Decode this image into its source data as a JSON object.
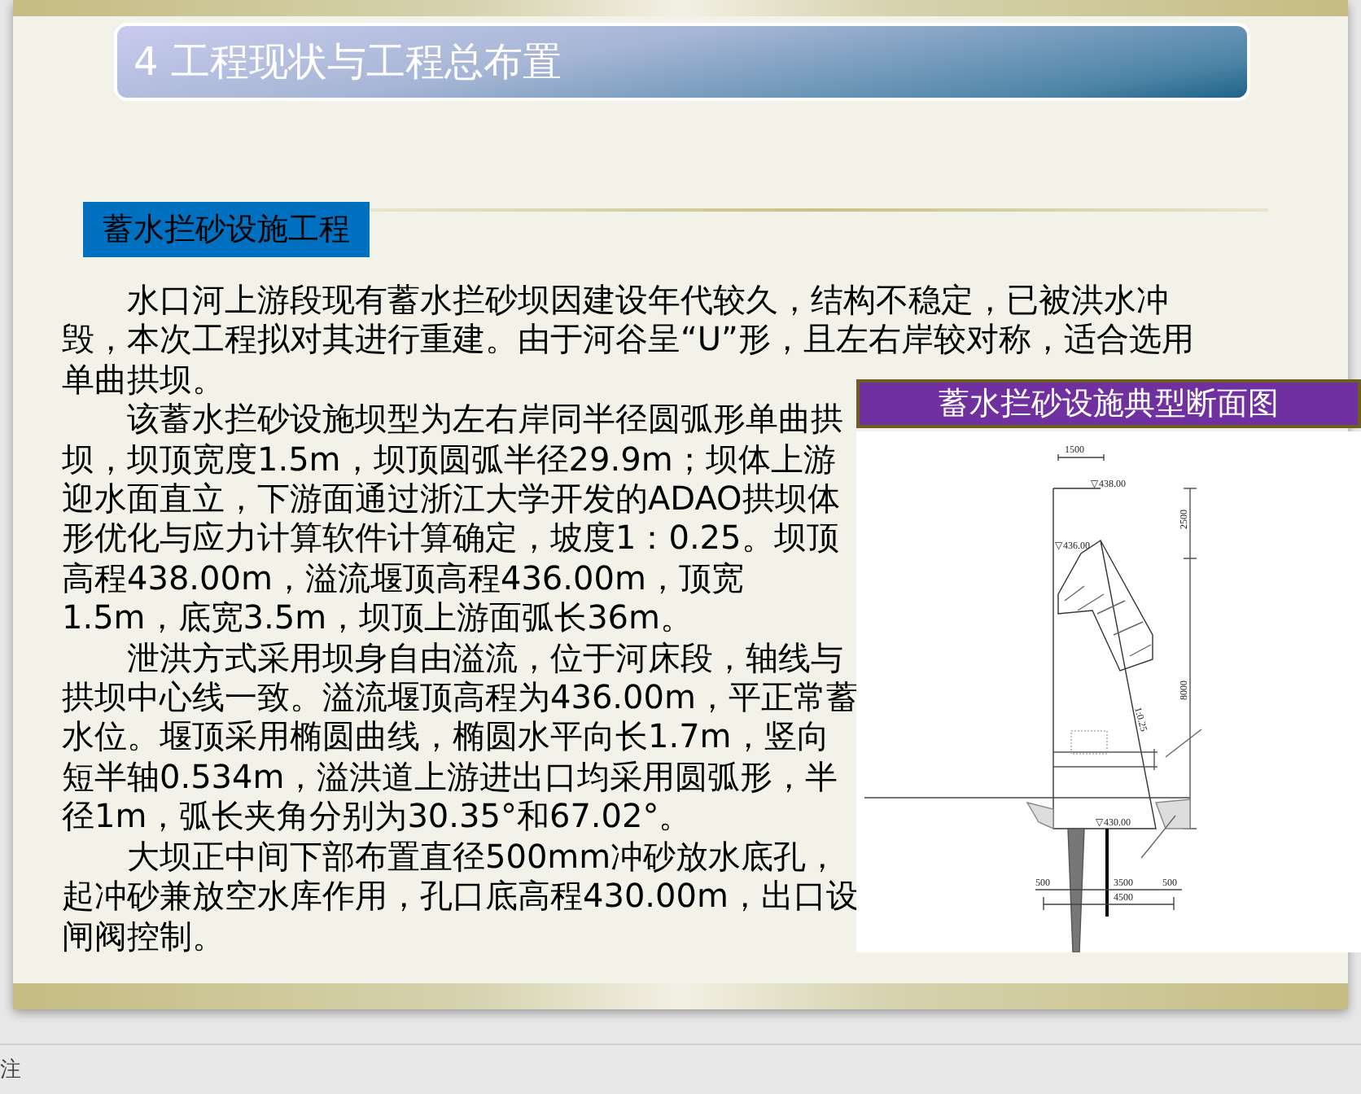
{
  "slide": {
    "title": "4 工程现状与工程总布置",
    "section_heading": "蓄水拦砂设施工程",
    "paragraphs": [
      "水口河上游段现有蓄水拦砂坝因建设年代较久，结构不稳定，已被洪水冲毁，本次工程拟对其进行重建。由于河谷呈“U”形，且左右岸较对称，适合选用单曲拱坝。",
      "该蓄水拦砂设施坝型为左右岸同半径圆弧形单曲拱坝，坝顶宽度1.5m，坝顶圆弧半径29.9m；坝体上游迎水面直立，下游面通过浙江大学开发的ADAO拱坝体形优化与应力计算软件计算确定，坡度1：0.25。坝顶高程438.00m，溢流堰顶高程436.00m，顶宽1.5m，底宽3.5m，坝顶上游面弧长36m。",
      "泄洪方式采用坝身自由溢流，位于河床段，轴线与拱坝中心线一致。溢流堰顶高程为436.00m，平正常蓄水位。堰顶采用椭圆曲线，椭圆水平向长1.7m，竖向短半轴0.534m，溢洪道上游进出口均采用圆弧形，半径1m，弧长夹角分别为30.35°和67.02°。",
      "大坝正中间下部布置直径500mm冲砂放水底孔，起冲砂兼放空水库作用，孔口底高程430.00m，出口设闸阀控制。"
    ],
    "figure": {
      "caption": "蓄水拦砂设施典型断面图",
      "labels": [
        "1500",
        "▽438.00",
        "2500",
        "▽436.00",
        "1:0.25",
        "8000",
        "▽430.00",
        "500",
        "3500",
        "500",
        "4500"
      ]
    }
  },
  "notes_pane": {
    "label": "注"
  }
}
